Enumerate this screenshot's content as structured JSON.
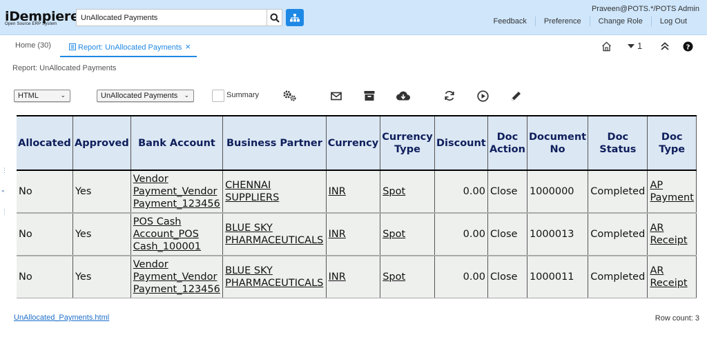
{
  "header": {
    "logo_main": "iDempiere",
    "logo_sub": "Open Source ERP System",
    "search_value": "UnAllocated Payments",
    "user": "Praveen@POTS.*/POTS Admin",
    "links": [
      "Feedback",
      "Preference",
      "Change Role",
      "Log Out"
    ],
    "bg_color": "#cfe6fb",
    "accent_color": "#1e88e5"
  },
  "tabs": {
    "home_label": "Home (30)",
    "report_label": "Report: UnAllocated Payments",
    "close_glyph": "×",
    "window_count": "1"
  },
  "subtitle": "Report: UnAllocated Payments",
  "controls": {
    "format_value": "HTML",
    "print_format_value": "UnAllocated Payments",
    "summary_label": "Summary",
    "summary_checked": false,
    "icons": [
      "gears-icon",
      "email-icon",
      "archive-icon",
      "download-icon",
      "refresh-icon",
      "run-icon",
      "edit-icon"
    ]
  },
  "report": {
    "columns": [
      "Allocated",
      "Approved",
      "Bank Account",
      "Business Partner",
      "Currency",
      "Currency Type",
      "Discount",
      "Doc Action",
      "Document No",
      "Doc Status",
      "Doc Type"
    ],
    "rows": [
      [
        "No",
        "Yes",
        "Vendor Payment_Vendor Payment_123456",
        "CHENNAI SUPPLIERS",
        "INR",
        "Spot",
        "0.00",
        "Close",
        "1000000",
        "Completed",
        "AP Payment"
      ],
      [
        "No",
        "Yes",
        "POS Cash Account_POS Cash_100001",
        "BLUE SKY PHARMACEUTICALS",
        "INR",
        "Spot",
        "0.00",
        "Close",
        "1000013",
        "Completed",
        "AR Receipt"
      ],
      [
        "No",
        "Yes",
        "Vendor Payment_Vendor Payment_123456",
        "BLUE SKY PHARMACEUTICALS",
        "INR",
        "Spot",
        "0.00",
        "Close",
        "1000011",
        "Completed",
        "AR Receipt"
      ]
    ]
  },
  "footer": {
    "file_link": "UnAllocated_Payments.html",
    "row_count": "Row count: 3"
  }
}
